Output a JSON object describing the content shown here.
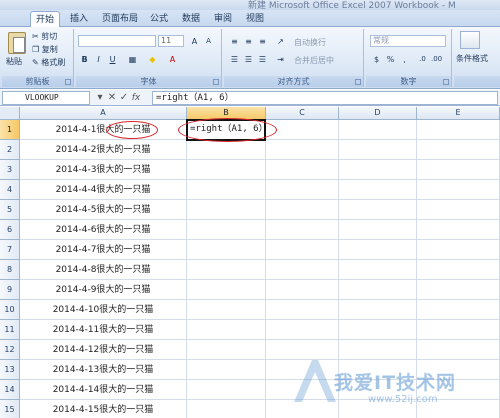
{
  "window": {
    "title": "新建 Microsoft Office Excel 2007 Workbook - M"
  },
  "tabs": [
    "开始",
    "插入",
    "页面布局",
    "公式",
    "数据",
    "审阅",
    "视图"
  ],
  "ribbon": {
    "clipboard": {
      "paste": "粘贴",
      "cut": "剪切",
      "copy": "复制",
      "format_painter": "格式刷",
      "label": "剪贴板"
    },
    "font": {
      "font_name": "",
      "font_size": "11",
      "grow": "A",
      "shrink": "A",
      "bold": "B",
      "italic": "I",
      "underline": "U",
      "label": "字体"
    },
    "alignment": {
      "wrap_text": "自动换行",
      "merge_center": "合并后居中",
      "label": "对齐方式"
    },
    "number": {
      "format": "常规",
      "label": "数字"
    },
    "styles": {
      "conditional": "条件格式"
    }
  },
  "formula_bar": {
    "name_box": "VLOOKUP",
    "cancel": "✕",
    "enter": "✓",
    "fx": "fx",
    "formula": "=right（A1, 6）"
  },
  "columns": [
    "A",
    "B",
    "C",
    "D",
    "E"
  ],
  "rows": [
    {
      "num": "1",
      "a": "2014-4-1很大的一只猫"
    },
    {
      "num": "2",
      "a": "2014-4-2很大的一只猫"
    },
    {
      "num": "3",
      "a": "2014-4-3很大的一只猫"
    },
    {
      "num": "4",
      "a": "2014-4-4很大的一只猫"
    },
    {
      "num": "5",
      "a": "2014-4-5很大的一只猫"
    },
    {
      "num": "6",
      "a": "2014-4-6很大的一只猫"
    },
    {
      "num": "7",
      "a": "2014-4-7很大的一只猫"
    },
    {
      "num": "8",
      "a": "2014-4-8很大的一只猫"
    },
    {
      "num": "9",
      "a": "2014-4-9很大的一只猫"
    },
    {
      "num": "10",
      "a": "2014-4-10很大的一只猫"
    },
    {
      "num": "11",
      "a": "2014-4-11很大的一只猫"
    },
    {
      "num": "12",
      "a": "2014-4-12很大的一只猫"
    },
    {
      "num": "13",
      "a": "2014-4-13很大的一只猫"
    },
    {
      "num": "14",
      "a": "2014-4-14很大的一只猫"
    },
    {
      "num": "15",
      "a": "2014-4-15很大的一只猫"
    }
  ],
  "active_cell": {
    "ref": "B1",
    "content": "=right（A1, 6）"
  },
  "watermark": {
    "text": "我爱IT技术网",
    "url": "www.52ij.com"
  }
}
